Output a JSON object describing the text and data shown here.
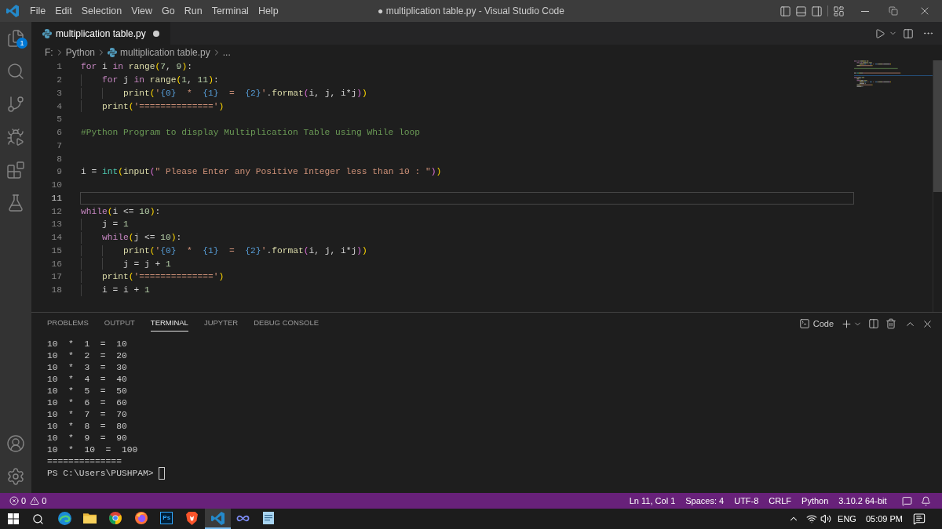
{
  "title_bar": {
    "menu": [
      "File",
      "Edit",
      "Selection",
      "View",
      "Go",
      "Run",
      "Terminal",
      "Help"
    ],
    "title": "● multiplication table.py - Visual Studio Code"
  },
  "activity_bar": {
    "items": [
      {
        "kind": "files",
        "selected": false,
        "badge": "1"
      },
      {
        "kind": "search",
        "selected": false
      },
      {
        "kind": "branch",
        "selected": false
      },
      {
        "kind": "debug",
        "selected": false
      },
      {
        "kind": "extensions",
        "selected": false
      },
      {
        "kind": "flask",
        "selected": false
      }
    ],
    "bottom_items": [
      {
        "kind": "account"
      },
      {
        "kind": "gear"
      }
    ]
  },
  "editor": {
    "tabs": [
      {
        "label": "multiplication table.py",
        "selected": true,
        "modified": true
      }
    ],
    "breadcrumb": [
      {
        "kind": "text",
        "label": "F:"
      },
      {
        "kind": "text",
        "label": "Python"
      },
      {
        "kind": "file",
        "label": "multiplication table.py"
      },
      {
        "kind": "text",
        "label": "..."
      }
    ],
    "lines": [
      {
        "number": "1",
        "current": false,
        "tokens": [
          {
            "kind": "kw",
            "text": "for"
          },
          {
            "kind": "txt",
            "text": " i "
          },
          {
            "kind": "kw",
            "text": "in "
          },
          {
            "kind": "fn",
            "text": "range"
          },
          {
            "kind": "b1",
            "text": "("
          },
          {
            "kind": "num",
            "text": "7"
          },
          {
            "kind": "txt",
            "text": ", "
          },
          {
            "kind": "num",
            "text": "9"
          },
          {
            "kind": "b1",
            "text": ")"
          },
          {
            "kind": "txt",
            "text": ":"
          }
        ]
      },
      {
        "number": "2",
        "current": false,
        "tokens": [
          {
            "kind": "kw",
            "text": "    for"
          },
          {
            "kind": "txt",
            "text": " j "
          },
          {
            "kind": "kw",
            "text": "in "
          },
          {
            "kind": "fn",
            "text": "range"
          },
          {
            "kind": "b1",
            "text": "("
          },
          {
            "kind": "num",
            "text": "1"
          },
          {
            "kind": "txt",
            "text": ", "
          },
          {
            "kind": "num",
            "text": "11"
          },
          {
            "kind": "b1",
            "text": ")"
          },
          {
            "kind": "txt",
            "text": ":"
          }
        ]
      },
      {
        "number": "3",
        "current": false,
        "tokens": [
          {
            "kind": "fn",
            "text": "        print"
          },
          {
            "kind": "b1",
            "text": "("
          },
          {
            "kind": "str",
            "text": "'"
          },
          {
            "kind": "ph",
            "text": "{0}"
          },
          {
            "kind": "str",
            "text": "  *  "
          },
          {
            "kind": "ph",
            "text": "{1}"
          },
          {
            "kind": "str",
            "text": "  =  "
          },
          {
            "kind": "ph",
            "text": "{2}"
          },
          {
            "kind": "str",
            "text": "'"
          },
          {
            "kind": "txt",
            "text": "."
          },
          {
            "kind": "fn",
            "text": "format"
          },
          {
            "kind": "b2",
            "text": "("
          },
          {
            "kind": "txt",
            "text": "i, j, i*j"
          },
          {
            "kind": "b2",
            "text": ")"
          },
          {
            "kind": "b1",
            "text": ")"
          }
        ]
      },
      {
        "number": "4",
        "current": false,
        "tokens": [
          {
            "kind": "fn",
            "text": "    print"
          },
          {
            "kind": "b1",
            "text": "("
          },
          {
            "kind": "str",
            "text": "'=============='"
          },
          {
            "kind": "b1",
            "text": ")"
          }
        ]
      },
      {
        "number": "5",
        "current": false
      },
      {
        "number": "6",
        "current": false,
        "tokens": [
          {
            "kind": "cmt",
            "text": "#Python Program to display Multiplication Table using While loop"
          }
        ]
      },
      {
        "number": "7",
        "current": false
      },
      {
        "number": "8",
        "current": false
      },
      {
        "number": "9",
        "current": false,
        "tokens": [
          {
            "kind": "txt",
            "text": "i = "
          },
          {
            "kind": "cls",
            "text": "int"
          },
          {
            "kind": "b1",
            "text": "("
          },
          {
            "kind": "fn",
            "text": "input"
          },
          {
            "kind": "b2",
            "text": "("
          },
          {
            "kind": "str",
            "text": "\" Please Enter any Positive Integer less than 10 : \""
          },
          {
            "kind": "b2",
            "text": ")"
          },
          {
            "kind": "b1",
            "text": ")"
          }
        ]
      },
      {
        "number": "10",
        "current": false
      },
      {
        "number": "11",
        "current": true
      },
      {
        "number": "12",
        "current": false,
        "tokens": [
          {
            "kind": "kw",
            "text": "while"
          },
          {
            "kind": "b1",
            "text": "("
          },
          {
            "kind": "txt",
            "text": "i <= "
          },
          {
            "kind": "num",
            "text": "10"
          },
          {
            "kind": "b1",
            "text": ")"
          },
          {
            "kind": "txt",
            "text": ":"
          }
        ]
      },
      {
        "number": "13",
        "current": false,
        "tokens": [
          {
            "kind": "txt",
            "text": "    j = "
          },
          {
            "kind": "num",
            "text": "1"
          }
        ]
      },
      {
        "number": "14",
        "current": false,
        "tokens": [
          {
            "kind": "kw",
            "text": "    while"
          },
          {
            "kind": "b1",
            "text": "("
          },
          {
            "kind": "txt",
            "text": "j <= "
          },
          {
            "kind": "num",
            "text": "10"
          },
          {
            "kind": "b1",
            "text": ")"
          },
          {
            "kind": "txt",
            "text": ":"
          }
        ]
      },
      {
        "number": "15",
        "current": false,
        "tokens": [
          {
            "kind": "fn",
            "text": "        print"
          },
          {
            "kind": "b1",
            "text": "("
          },
          {
            "kind": "str",
            "text": "'"
          },
          {
            "kind": "ph",
            "text": "{0}"
          },
          {
            "kind": "str",
            "text": "  *  "
          },
          {
            "kind": "ph",
            "text": "{1}"
          },
          {
            "kind": "str",
            "text": "  =  "
          },
          {
            "kind": "ph",
            "text": "{2}"
          },
          {
            "kind": "str",
            "text": "'"
          },
          {
            "kind": "txt",
            "text": "."
          },
          {
            "kind": "fn",
            "text": "format"
          },
          {
            "kind": "b2",
            "text": "("
          },
          {
            "kind": "txt",
            "text": "i, j, i*j"
          },
          {
            "kind": "b2",
            "text": ")"
          },
          {
            "kind": "b1",
            "text": ")"
          }
        ]
      },
      {
        "number": "16",
        "current": false,
        "tokens": [
          {
            "kind": "txt",
            "text": "        j = j + "
          },
          {
            "kind": "num",
            "text": "1"
          }
        ]
      },
      {
        "number": "17",
        "current": false,
        "tokens": [
          {
            "kind": "fn",
            "text": "    print"
          },
          {
            "kind": "b1",
            "text": "("
          },
          {
            "kind": "str",
            "text": "'=============='"
          },
          {
            "kind": "b1",
            "text": ")"
          }
        ]
      },
      {
        "number": "18",
        "current": false,
        "tokens": [
          {
            "kind": "txt",
            "text": "    i = i + "
          },
          {
            "kind": "num",
            "text": "1"
          }
        ]
      }
    ]
  },
  "panel": {
    "tabs": [
      {
        "label": "PROBLEMS",
        "selected": false
      },
      {
        "label": "OUTPUT",
        "selected": false
      },
      {
        "label": "TERMINAL",
        "selected": true
      },
      {
        "label": "JUPYTER",
        "selected": false
      },
      {
        "label": "DEBUG CONSOLE",
        "selected": false
      }
    ],
    "terminal_name": "Code",
    "terminal_lines": [
      "10  *  1  =  10",
      "10  *  2  =  20",
      "10  *  3  =  30",
      "10  *  4  =  40",
      "10  *  5  =  50",
      "10  *  6  =  60",
      "10  *  7  =  70",
      "10  *  8  =  80",
      "10  *  9  =  90",
      "10  *  10  =  100",
      "=============="
    ],
    "prompt": "PS C:\\Users\\PUSHPAM>"
  },
  "status_bar": {
    "errors": "0",
    "warnings": "0",
    "items": [
      "Ln 11, Col 1",
      "Spaces: 4",
      "UTF-8",
      "CRLF",
      "Python",
      "3.10.2 64-bit"
    ]
  },
  "taskbar": {
    "apps": [
      {
        "kind": "swirl",
        "selected": false
      },
      {
        "kind": "folder",
        "selected": false
      },
      {
        "kind": "ring",
        "selected": false
      },
      {
        "kind": "flame",
        "selected": false
      },
      {
        "kind": "tile",
        "label": "Ps",
        "selected": false
      },
      {
        "kind": "shield",
        "selected": false
      },
      {
        "kind": "ribbon",
        "selected": true
      },
      {
        "kind": "infinity",
        "selected": false
      },
      {
        "kind": "notepad",
        "selected": false
      }
    ],
    "tray": {
      "language": "ENG",
      "time": "05:09 PM"
    }
  }
}
